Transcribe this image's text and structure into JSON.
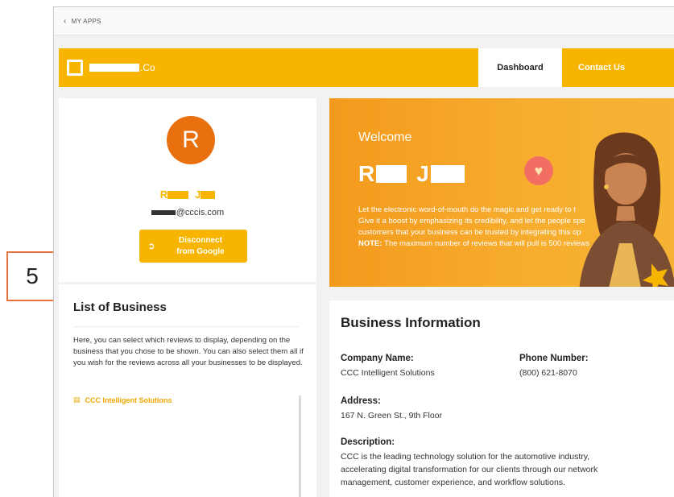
{
  "step_marker": "5",
  "topbar": {
    "back_label": "MY APPS"
  },
  "nav": {
    "brand_suffix": ".Co",
    "tabs": [
      {
        "label": "Dashboard"
      },
      {
        "label": "Contact Us"
      }
    ]
  },
  "profile": {
    "avatar_letter": "R",
    "first_initial": "R",
    "last_initial": "J",
    "email_domain": "@cccis.com",
    "disconnect_label_line1": "Disconnect",
    "disconnect_label_line2": "from Google"
  },
  "list_of_business": {
    "title": "List of Business",
    "description": "Here, you can select which reviews to display, depending on the business that you chose to be shown. You can also select them all if you wish for the reviews across all your businesses to be displayed.",
    "items": [
      {
        "label": "CCC Intelligent Solutions"
      }
    ]
  },
  "welcome": {
    "greeting": "Welcome",
    "first_initial": "R",
    "last_initial": "J",
    "line1": "Let the electronic word-of-mouth do the magic and get ready to t",
    "line2": "Give it a boost by emphasizing its credibility, and let the people spe",
    "line3": "customers that your business can be trusted by integrating this op",
    "note_label": "NOTE:",
    "note_text": " The maximum number of reviews that will pull is 500 reviews"
  },
  "business_info": {
    "title": "Business Information",
    "company_label": "Company Name:",
    "company_value": "CCC Intelligent Solutions",
    "phone_label": "Phone Number:",
    "phone_value": "(800) 621-8070",
    "address_label": "Address:",
    "address_value": "167 N. Green St., 9th Floor",
    "description_label": "Description:",
    "description_line1": "CCC is the leading technology solution for the automotive industry,",
    "description_line2": "accelerating digital transformation for our clients through our network",
    "description_line3": "management, customer experience, and workflow solutions."
  },
  "colors": {
    "brand_yellow": "#f7b500",
    "avatar_orange": "#e8700e",
    "step_border": "#e8743b"
  }
}
